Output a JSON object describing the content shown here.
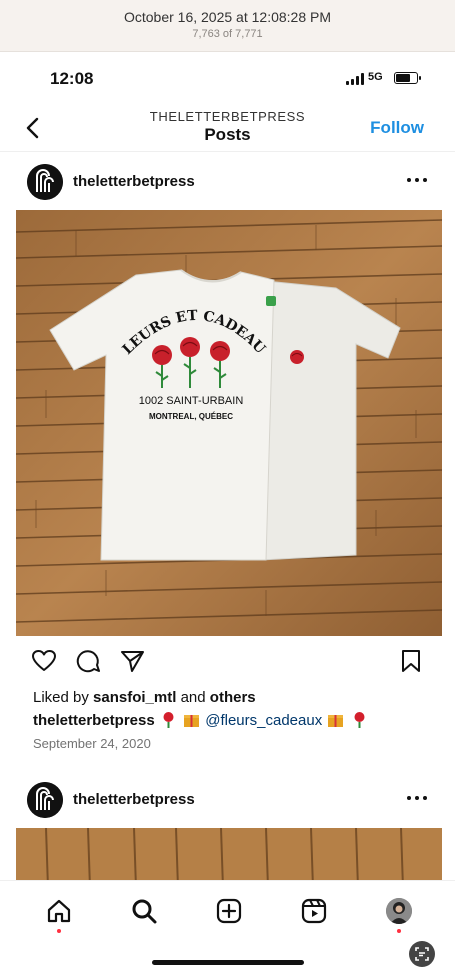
{
  "photo_meta": {
    "date": "October 16, 2025 at 12:08:28 PM",
    "count": "7,763 of 7,771"
  },
  "status_bar": {
    "time": "12:08",
    "network": "5G",
    "battery_percent": 70
  },
  "header": {
    "account": "THELETTERBETPRESS",
    "title": "Posts",
    "follow_label": "Follow"
  },
  "post": {
    "username": "theletterbetpress",
    "shirt_text": {
      "arch": "FLEURS ET CADEAUX",
      "address": "1002 SAINT-URBAIN",
      "city": "MONTREAL, QUÉBEC"
    },
    "liked_prefix": "Liked by",
    "liked_user": "sansfoi_mtl",
    "liked_and": "and",
    "liked_others": "others",
    "caption_user": "theletterbetpress",
    "caption_mention": "@fleurs_cadeaux",
    "date": "September 24, 2020"
  },
  "post2": {
    "username": "theletterbetpress"
  },
  "icons": {
    "back": "chevron-left-icon",
    "more": "more-horizontal-icon",
    "like": "heart-icon",
    "comment": "comment-icon",
    "share": "paper-plane-icon",
    "save": "bookmark-icon",
    "home": "home-icon",
    "search": "search-icon",
    "create": "plus-square-icon",
    "reels": "reels-icon",
    "profile": "profile-avatar-icon"
  },
  "colors": {
    "follow": "#1e8fe1",
    "mention": "#00376b",
    "notification_dot": "#ff3040",
    "floor": "#b07a45"
  }
}
